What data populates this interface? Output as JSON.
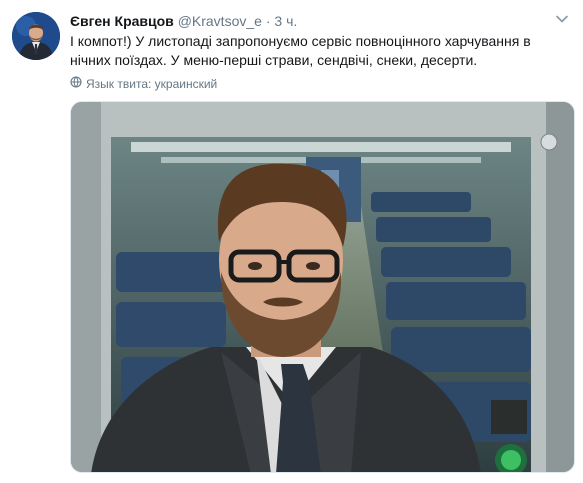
{
  "tweet": {
    "author_name": "Євген Кравцов",
    "handle": "@Kravtsov_e",
    "separator": "·",
    "time": "3 ч.",
    "text": "І компот!) У листопаді запропонуємо сервіс повноцінного харчування в нічних поїздах.  У меню-перші страви, сендвічі, снеки, десерти.",
    "translate_label": "Язык твита: украинский"
  },
  "icons": {
    "menu": "chevron-down-icon",
    "translate": "globe-icon"
  },
  "colors": {
    "text": "#14171a",
    "secondary": "#657786",
    "border": "#e1e8ed",
    "avatar_bg": "#1d3f7a"
  }
}
